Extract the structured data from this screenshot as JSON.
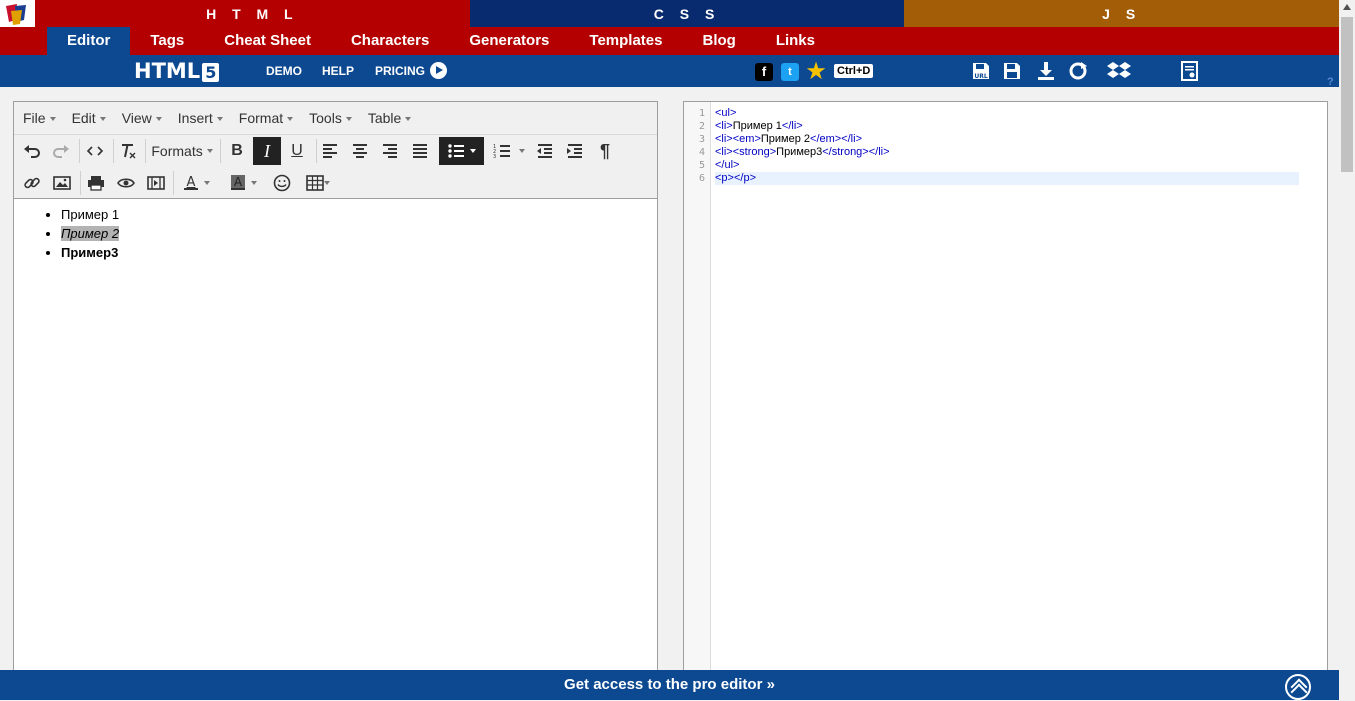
{
  "top_tabs": [
    "H T M L",
    "C S S",
    "J S"
  ],
  "nav": {
    "items": [
      "Editor",
      "Tags",
      "Cheat Sheet",
      "Characters",
      "Generators",
      "Templates",
      "Blog",
      "Links"
    ],
    "active": "Editor"
  },
  "bluebar": {
    "logo": "HTML",
    "logo_badge": "5",
    "demo": "DEMO",
    "help": "HELP",
    "pricing": "PRICING",
    "shortcut": "Ctrl+D",
    "fb": "f",
    "tw": "t"
  },
  "editor": {
    "menus": [
      "File",
      "Edit",
      "View",
      "Insert",
      "Format",
      "Tools",
      "Table"
    ],
    "formats_label": "Formats",
    "list": [
      "Пример 1",
      "Пример 2",
      "Пример3"
    ]
  },
  "code": {
    "line_numbers": [
      "1",
      "2",
      "3",
      "4",
      "5",
      "6"
    ],
    "lines": [
      [
        "<ul>",
        ""
      ],
      [
        "<li>",
        "Пример 1",
        "</li>"
      ],
      [
        "<li><em>",
        "Пример 2",
        "</em></li>"
      ],
      [
        "<li><strong>",
        "Пример3",
        "</strong></li>"
      ],
      [
        "</ul>",
        ""
      ],
      [
        "<p></p>",
        ""
      ]
    ]
  },
  "bottom_bar": "Get access to the pro editor »",
  "help_mark": "?",
  "colors": {
    "html_red": "#b40000",
    "css_blue": "#082b6f",
    "js_orange": "#a25d06",
    "bar_blue": "#0c4991"
  }
}
